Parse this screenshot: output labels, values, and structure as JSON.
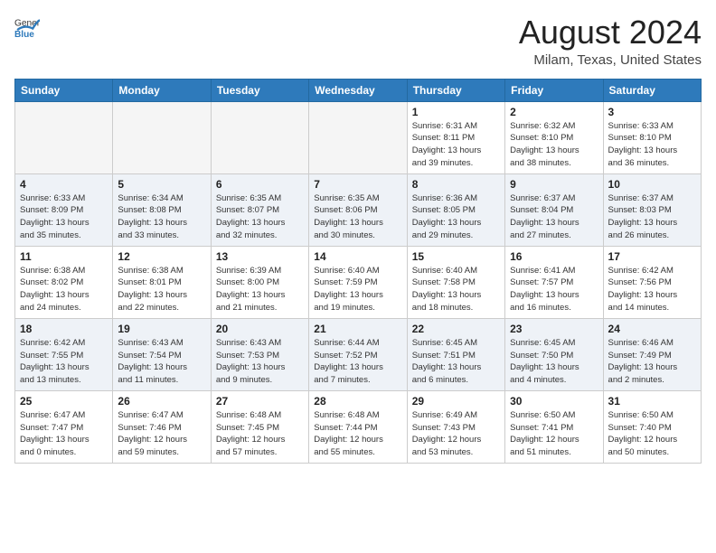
{
  "header": {
    "logo_general": "General",
    "logo_blue": "Blue",
    "month_title": "August 2024",
    "location": "Milam, Texas, United States"
  },
  "weekdays": [
    "Sunday",
    "Monday",
    "Tuesday",
    "Wednesday",
    "Thursday",
    "Friday",
    "Saturday"
  ],
  "weeks": [
    [
      {
        "day": "",
        "info": ""
      },
      {
        "day": "",
        "info": ""
      },
      {
        "day": "",
        "info": ""
      },
      {
        "day": "",
        "info": ""
      },
      {
        "day": "1",
        "info": "Sunrise: 6:31 AM\nSunset: 8:11 PM\nDaylight: 13 hours\nand 39 minutes."
      },
      {
        "day": "2",
        "info": "Sunrise: 6:32 AM\nSunset: 8:10 PM\nDaylight: 13 hours\nand 38 minutes."
      },
      {
        "day": "3",
        "info": "Sunrise: 6:33 AM\nSunset: 8:10 PM\nDaylight: 13 hours\nand 36 minutes."
      }
    ],
    [
      {
        "day": "4",
        "info": "Sunrise: 6:33 AM\nSunset: 8:09 PM\nDaylight: 13 hours\nand 35 minutes."
      },
      {
        "day": "5",
        "info": "Sunrise: 6:34 AM\nSunset: 8:08 PM\nDaylight: 13 hours\nand 33 minutes."
      },
      {
        "day": "6",
        "info": "Sunrise: 6:35 AM\nSunset: 8:07 PM\nDaylight: 13 hours\nand 32 minutes."
      },
      {
        "day": "7",
        "info": "Sunrise: 6:35 AM\nSunset: 8:06 PM\nDaylight: 13 hours\nand 30 minutes."
      },
      {
        "day": "8",
        "info": "Sunrise: 6:36 AM\nSunset: 8:05 PM\nDaylight: 13 hours\nand 29 minutes."
      },
      {
        "day": "9",
        "info": "Sunrise: 6:37 AM\nSunset: 8:04 PM\nDaylight: 13 hours\nand 27 minutes."
      },
      {
        "day": "10",
        "info": "Sunrise: 6:37 AM\nSunset: 8:03 PM\nDaylight: 13 hours\nand 26 minutes."
      }
    ],
    [
      {
        "day": "11",
        "info": "Sunrise: 6:38 AM\nSunset: 8:02 PM\nDaylight: 13 hours\nand 24 minutes."
      },
      {
        "day": "12",
        "info": "Sunrise: 6:38 AM\nSunset: 8:01 PM\nDaylight: 13 hours\nand 22 minutes."
      },
      {
        "day": "13",
        "info": "Sunrise: 6:39 AM\nSunset: 8:00 PM\nDaylight: 13 hours\nand 21 minutes."
      },
      {
        "day": "14",
        "info": "Sunrise: 6:40 AM\nSunset: 7:59 PM\nDaylight: 13 hours\nand 19 minutes."
      },
      {
        "day": "15",
        "info": "Sunrise: 6:40 AM\nSunset: 7:58 PM\nDaylight: 13 hours\nand 18 minutes."
      },
      {
        "day": "16",
        "info": "Sunrise: 6:41 AM\nSunset: 7:57 PM\nDaylight: 13 hours\nand 16 minutes."
      },
      {
        "day": "17",
        "info": "Sunrise: 6:42 AM\nSunset: 7:56 PM\nDaylight: 13 hours\nand 14 minutes."
      }
    ],
    [
      {
        "day": "18",
        "info": "Sunrise: 6:42 AM\nSunset: 7:55 PM\nDaylight: 13 hours\nand 13 minutes."
      },
      {
        "day": "19",
        "info": "Sunrise: 6:43 AM\nSunset: 7:54 PM\nDaylight: 13 hours\nand 11 minutes."
      },
      {
        "day": "20",
        "info": "Sunrise: 6:43 AM\nSunset: 7:53 PM\nDaylight: 13 hours\nand 9 minutes."
      },
      {
        "day": "21",
        "info": "Sunrise: 6:44 AM\nSunset: 7:52 PM\nDaylight: 13 hours\nand 7 minutes."
      },
      {
        "day": "22",
        "info": "Sunrise: 6:45 AM\nSunset: 7:51 PM\nDaylight: 13 hours\nand 6 minutes."
      },
      {
        "day": "23",
        "info": "Sunrise: 6:45 AM\nSunset: 7:50 PM\nDaylight: 13 hours\nand 4 minutes."
      },
      {
        "day": "24",
        "info": "Sunrise: 6:46 AM\nSunset: 7:49 PM\nDaylight: 13 hours\nand 2 minutes."
      }
    ],
    [
      {
        "day": "25",
        "info": "Sunrise: 6:47 AM\nSunset: 7:47 PM\nDaylight: 13 hours\nand 0 minutes."
      },
      {
        "day": "26",
        "info": "Sunrise: 6:47 AM\nSunset: 7:46 PM\nDaylight: 12 hours\nand 59 minutes."
      },
      {
        "day": "27",
        "info": "Sunrise: 6:48 AM\nSunset: 7:45 PM\nDaylight: 12 hours\nand 57 minutes."
      },
      {
        "day": "28",
        "info": "Sunrise: 6:48 AM\nSunset: 7:44 PM\nDaylight: 12 hours\nand 55 minutes."
      },
      {
        "day": "29",
        "info": "Sunrise: 6:49 AM\nSunset: 7:43 PM\nDaylight: 12 hours\nand 53 minutes."
      },
      {
        "day": "30",
        "info": "Sunrise: 6:50 AM\nSunset: 7:41 PM\nDaylight: 12 hours\nand 51 minutes."
      },
      {
        "day": "31",
        "info": "Sunrise: 6:50 AM\nSunset: 7:40 PM\nDaylight: 12 hours\nand 50 minutes."
      }
    ]
  ]
}
